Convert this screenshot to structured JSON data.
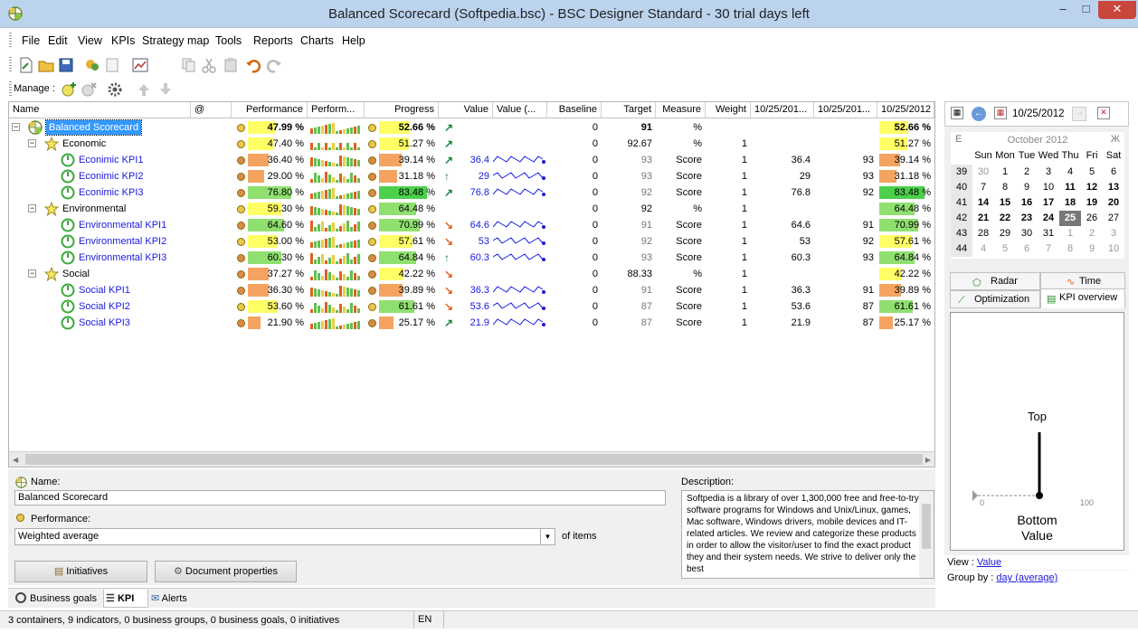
{
  "window": {
    "title": "Balanced Scorecard (Softpedia.bsc) - BSC Designer Standard - 30 trial days left",
    "min": "–",
    "max": "□",
    "close": "✕"
  },
  "menu": [
    "File",
    "Edit",
    "View",
    "KPIs",
    "Strategy map",
    "Tools",
    "Reports",
    "Charts",
    "Help"
  ],
  "manage_label": "Manage :",
  "columns": {
    "name": "Name",
    "at": "@",
    "performance": "Performance",
    "perform_spark": "Perform...",
    "progress": "Progress",
    "value": "Value",
    "value_spark": "Value (...",
    "baseline": "Baseline",
    "target": "Target",
    "measure": "Measure",
    "weight": "Weight",
    "d1": "10/25/201...",
    "d2": "10/25/201...",
    "d3": "10/25/2012"
  },
  "rows": [
    {
      "name": "Balanced Scorecard",
      "level": 0,
      "type": "root",
      "perf": "47.99 %",
      "perf_v": 47.99,
      "perf_color": "#ffff66",
      "dot": "#e8c84a",
      "progress": "52.66 %",
      "prog_v": 52.66,
      "prog_color": "#ffff66",
      "arrow": "↗",
      "arrow_color": "#1c7f3c",
      "value": "",
      "baseline": "0",
      "target": "91",
      "measure": "%",
      "weight": "",
      "d1": "",
      "d2": "",
      "d3": "52.66 %",
      "d3_v": 52.66,
      "d3_color": "#ffff66",
      "bold": true
    },
    {
      "name": "Economic",
      "level": 1,
      "type": "container",
      "perf": "47.40 %",
      "perf_v": 47.4,
      "perf_color": "#ffff66",
      "dot": "#e8c84a",
      "progress": "51.27 %",
      "prog_v": 51.27,
      "prog_color": "#ffff66",
      "arrow": "↗",
      "arrow_color": "#1c7f3c",
      "value": "",
      "baseline": "0",
      "target": "92.67",
      "measure": "%",
      "weight": "1",
      "d1": "",
      "d2": "",
      "d3": "51.27 %",
      "d3_v": 51.27,
      "d3_color": "#ffff66"
    },
    {
      "name": "Econimic KPI1",
      "level": 2,
      "type": "kpi",
      "perf": "36.40 %",
      "perf_v": 36.4,
      "perf_color": "#f4a460",
      "dot": "#d98a4a",
      "progress": "39.14 %",
      "prog_v": 39.14,
      "prog_color": "#f4a460",
      "arrow": "↗",
      "arrow_color": "#1c7f3c",
      "value": "36.4",
      "baseline": "0",
      "target": "93",
      "measure": "Score",
      "weight": "1",
      "d1": "36.4",
      "d2": "93",
      "d3": "39.14 %",
      "d3_v": 39.14,
      "d3_color": "#f4a460"
    },
    {
      "name": "Econimic KPI2",
      "level": 2,
      "type": "kpi",
      "perf": "29.00 %",
      "perf_v": 29.0,
      "perf_color": "#f4a460",
      "dot": "#d98a4a",
      "progress": "31.18 %",
      "prog_v": 31.18,
      "prog_color": "#f4a460",
      "arrow": "↑",
      "arrow_color": "#1c7f3c",
      "value": "29",
      "baseline": "0",
      "target": "93",
      "measure": "Score",
      "weight": "1",
      "d1": "29",
      "d2": "93",
      "d3": "31.18 %",
      "d3_v": 31.18,
      "d3_color": "#f4a460"
    },
    {
      "name": "Econimic KPI3",
      "level": 2,
      "type": "kpi",
      "perf": "76.80 %",
      "perf_v": 76.8,
      "perf_color": "#90e070",
      "dot": "#d98a4a",
      "progress": "83.48 %",
      "prog_v": 83.48,
      "prog_color": "#4cd04c",
      "arrow": "↗",
      "arrow_color": "#1c7f3c",
      "value": "76.8",
      "baseline": "0",
      "target": "92",
      "measure": "Score",
      "weight": "1",
      "d1": "76.8",
      "d2": "92",
      "d3": "83.48 %",
      "d3_v": 83.48,
      "d3_color": "#4cd04c"
    },
    {
      "name": "Environmental",
      "level": 1,
      "type": "container",
      "perf": "59.30 %",
      "perf_v": 59.3,
      "perf_color": "#ffff66",
      "dot": "#e8c84a",
      "progress": "64.48 %",
      "prog_v": 64.48,
      "prog_color": "#90e070",
      "arrow": "",
      "arrow_color": "#1c7f3c",
      "value": "",
      "baseline": "0",
      "target": "92",
      "measure": "%",
      "weight": "1",
      "d1": "",
      "d2": "",
      "d3": "64.48 %",
      "d3_v": 64.48,
      "d3_color": "#90e070"
    },
    {
      "name": "Environmental KPI1",
      "level": 2,
      "type": "kpi",
      "perf": "64.60 %",
      "perf_v": 64.6,
      "perf_color": "#90e070",
      "dot": "#d98a4a",
      "progress": "70.99 %",
      "prog_v": 70.99,
      "prog_color": "#90e070",
      "arrow": "↘",
      "arrow_color": "#e06020",
      "value": "64.6",
      "baseline": "0",
      "target": "91",
      "measure": "Score",
      "weight": "1",
      "d1": "64.6",
      "d2": "91",
      "d3": "70.99 %",
      "d3_v": 70.99,
      "d3_color": "#90e070"
    },
    {
      "name": "Environmental KPI2",
      "level": 2,
      "type": "kpi",
      "perf": "53.00 %",
      "perf_v": 53.0,
      "perf_color": "#ffff66",
      "dot": "#e8c84a",
      "progress": "57.61 %",
      "prog_v": 57.61,
      "prog_color": "#ffff66",
      "arrow": "↘",
      "arrow_color": "#e06020",
      "value": "53",
      "baseline": "0",
      "target": "92",
      "measure": "Score",
      "weight": "1",
      "d1": "53",
      "d2": "92",
      "d3": "57.61 %",
      "d3_v": 57.61,
      "d3_color": "#ffff66"
    },
    {
      "name": "Environmental KPI3",
      "level": 2,
      "type": "kpi",
      "perf": "60.30 %",
      "perf_v": 60.3,
      "perf_color": "#90e070",
      "dot": "#d98a4a",
      "progress": "64.84 %",
      "prog_v": 64.84,
      "prog_color": "#90e070",
      "arrow": "↑",
      "arrow_color": "#1c7f3c",
      "value": "60.3",
      "baseline": "0",
      "target": "93",
      "measure": "Score",
      "weight": "1",
      "d1": "60.3",
      "d2": "93",
      "d3": "64.84 %",
      "d3_v": 64.84,
      "d3_color": "#90e070"
    },
    {
      "name": "Social",
      "level": 1,
      "type": "container",
      "perf": "37.27 %",
      "perf_v": 37.27,
      "perf_color": "#f4a460",
      "dot": "#d98a4a",
      "progress": "42.22 %",
      "prog_v": 42.22,
      "prog_color": "#ffff66",
      "arrow": "↘",
      "arrow_color": "#e06020",
      "value": "",
      "baseline": "0",
      "target": "88.33",
      "measure": "%",
      "weight": "1",
      "d1": "",
      "d2": "",
      "d3": "42.22 %",
      "d3_v": 42.22,
      "d3_color": "#ffff66"
    },
    {
      "name": "Social KPI1",
      "level": 2,
      "type": "kpi",
      "perf": "36.30 %",
      "perf_v": 36.3,
      "perf_color": "#f4a460",
      "dot": "#d98a4a",
      "progress": "39.89 %",
      "prog_v": 39.89,
      "prog_color": "#f4a460",
      "arrow": "↘",
      "arrow_color": "#e06020",
      "value": "36.3",
      "baseline": "0",
      "target": "91",
      "measure": "Score",
      "weight": "1",
      "d1": "36.3",
      "d2": "91",
      "d3": "39.89 %",
      "d3_v": 39.89,
      "d3_color": "#f4a460"
    },
    {
      "name": "Social KPI2",
      "level": 2,
      "type": "kpi",
      "perf": "53.60 %",
      "perf_v": 53.6,
      "perf_color": "#ffff66",
      "dot": "#e8c84a",
      "progress": "61.61 %",
      "prog_v": 61.61,
      "prog_color": "#90e070",
      "arrow": "↘",
      "arrow_color": "#e06020",
      "value": "53.6",
      "baseline": "0",
      "target": "87",
      "measure": "Score",
      "weight": "1",
      "d1": "53.6",
      "d2": "87",
      "d3": "61.61 %",
      "d3_v": 61.61,
      "d3_color": "#90e070"
    },
    {
      "name": "Social KPI3",
      "level": 2,
      "type": "kpi",
      "perf": "21.90 %",
      "perf_v": 21.9,
      "perf_color": "#f4a460",
      "dot": "#d98a4a",
      "progress": "25.17 %",
      "prog_v": 25.17,
      "prog_color": "#f4a460",
      "arrow": "↗",
      "arrow_color": "#1c7f3c",
      "value": "21.9",
      "baseline": "0",
      "target": "87",
      "measure": "Score",
      "weight": "1",
      "d1": "21.9",
      "d2": "87",
      "d3": "25.17 %",
      "d3_v": 25.17,
      "d3_color": "#f4a460"
    }
  ],
  "details": {
    "name_label": "Name:",
    "name_value": "Balanced Scorecard",
    "performance_label": "Performance:",
    "performance_value": "Weighted average",
    "of_items": "of items",
    "description_label": "Description:",
    "description": "Softpedia is a library of over 1,300,000 free and free-to-try software programs for Windows and Unix/Linux, games, Mac software, Windows drivers, mobile devices and IT-related articles. We review and categorize these products in order to allow the visitor/user to find the exact product they and their system needs. We strive to deliver only the best",
    "initiatives_button": "Initiatives",
    "document_properties_button": "Document properties"
  },
  "bottom_tabs": [
    "Business goals",
    "KPI",
    "Alerts"
  ],
  "status": {
    "summary": "3 containers, 9 indicators, 0 business groups, 0 business goals, 0 initiatives",
    "lang": "EN"
  },
  "calendar": {
    "date": "10/25/2012",
    "month_title": "October 2012",
    "prev": "Е",
    "next": "Ж",
    "weekdays": [
      "Sun",
      "Mon",
      "Tue",
      "Wed",
      "Thu",
      "Fri",
      "Sat"
    ],
    "weeks": [
      {
        "wk": "39",
        "days": [
          "30",
          "1",
          "2",
          "3",
          "4",
          "5",
          "6"
        ]
      },
      {
        "wk": "40",
        "days": [
          "7",
          "8",
          "9",
          "10",
          "11",
          "12",
          "13"
        ]
      },
      {
        "wk": "41",
        "days": [
          "14",
          "15",
          "16",
          "17",
          "18",
          "19",
          "20"
        ]
      },
      {
        "wk": "42",
        "days": [
          "21",
          "22",
          "23",
          "24",
          "25",
          "26",
          "27"
        ]
      },
      {
        "wk": "43",
        "days": [
          "28",
          "29",
          "30",
          "31",
          "1",
          "2",
          "3"
        ]
      },
      {
        "wk": "44",
        "days": [
          "4",
          "5",
          "6",
          "7",
          "8",
          "9",
          "10"
        ]
      }
    ],
    "selected": "25"
  },
  "right_tabs": [
    "Radar",
    "Time",
    "Optimization",
    "KPI overview"
  ],
  "gauge": {
    "top": "Top",
    "bottom": "Bottom",
    "value_label": "Value",
    "min": "0",
    "max": "100"
  },
  "view": {
    "label": "View :",
    "value": "Value"
  },
  "group_by": {
    "label": "Group by :",
    "value": "day (average)"
  }
}
